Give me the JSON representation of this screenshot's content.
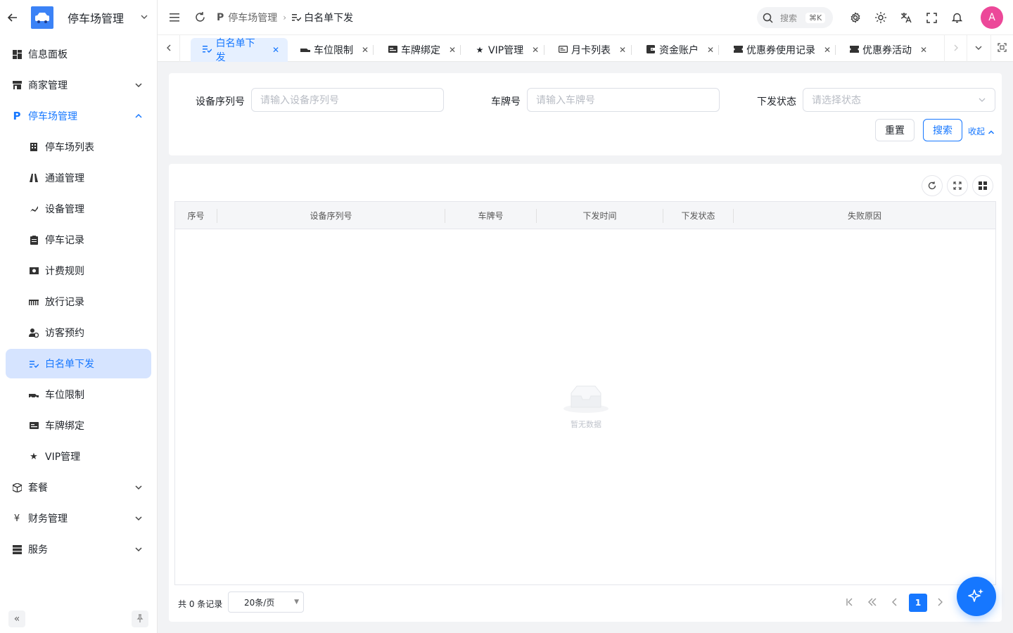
{
  "app": {
    "title": "停车场管理"
  },
  "sidebar": {
    "items": [
      {
        "label": "信息面板",
        "icon": "dashboard-icon",
        "level": 1,
        "expandable": false
      },
      {
        "label": "商家管理",
        "icon": "store-icon",
        "level": 1,
        "expandable": true
      },
      {
        "label": "停车场管理",
        "icon": "parking-icon",
        "level": 1,
        "expandable": true,
        "expanded": true
      },
      {
        "label": "停车场列表",
        "icon": "building-icon",
        "level": 2
      },
      {
        "label": "通道管理",
        "icon": "road-icon",
        "level": 2
      },
      {
        "label": "设备管理",
        "icon": "camera-icon",
        "level": 2
      },
      {
        "label": "停车记录",
        "icon": "clipboard-icon",
        "level": 2
      },
      {
        "label": "计费规则",
        "icon": "money-icon",
        "level": 2
      },
      {
        "label": "放行记录",
        "icon": "gate-icon",
        "level": 2
      },
      {
        "label": "访客预约",
        "icon": "visitor-icon",
        "level": 2
      },
      {
        "label": "白名单下发",
        "icon": "list-check-icon",
        "level": 2,
        "selected": true
      },
      {
        "label": "车位限制",
        "icon": "car-icon",
        "level": 2
      },
      {
        "label": "车牌绑定",
        "icon": "card-icon",
        "level": 2
      },
      {
        "label": "VIP管理",
        "icon": "star-icon",
        "level": 2
      },
      {
        "label": "套餐",
        "icon": "package-icon",
        "level": 1,
        "expandable": true
      },
      {
        "label": "财务管理",
        "icon": "yen-icon",
        "level": 1,
        "expandable": true
      },
      {
        "label": "服务",
        "icon": "server-icon",
        "level": 1,
        "expandable": true
      }
    ]
  },
  "topbar": {
    "breadcrumb": [
      {
        "label": "停车场管理",
        "icon": "parking-icon"
      },
      {
        "label": "白名单下发",
        "icon": "list-check-icon"
      }
    ],
    "search_label": "搜索",
    "search_shortcut": "⌘K",
    "avatar_letter": "A"
  },
  "tabs": [
    {
      "label": "白名单下发",
      "icon": "list-check-icon",
      "active": true
    },
    {
      "label": "车位限制",
      "icon": "car-icon"
    },
    {
      "label": "车牌绑定",
      "icon": "card-icon"
    },
    {
      "label": "VIP管理",
      "icon": "star-icon"
    },
    {
      "label": "月卡列表",
      "icon": "id-card-icon"
    },
    {
      "label": "资金账户",
      "icon": "wallet-icon"
    },
    {
      "label": "优惠券使用记录",
      "icon": "ticket-icon"
    },
    {
      "label": "优惠券活动",
      "icon": "ticket-icon"
    }
  ],
  "filters": {
    "device_serial": {
      "label": "设备序列号",
      "placeholder": "请输入设备序列号"
    },
    "plate": {
      "label": "车牌号",
      "placeholder": "请输入车牌号"
    },
    "status": {
      "label": "下发状态",
      "placeholder": "请选择状态"
    },
    "reset_label": "重置",
    "search_label": "搜索",
    "collapse_label": "收起"
  },
  "table": {
    "columns": [
      "序号",
      "设备序列号",
      "车牌号",
      "下发时间",
      "下发状态",
      "失败原因"
    ],
    "rows": [],
    "empty_text": "暂无数据"
  },
  "pagination": {
    "total_text": "共 0 条记录",
    "page_size": "20条/页",
    "current_page": "1"
  },
  "colors": {
    "primary": "#1677ff",
    "selected_bg": "#d6e4ff",
    "avatar": "#ec4899"
  }
}
